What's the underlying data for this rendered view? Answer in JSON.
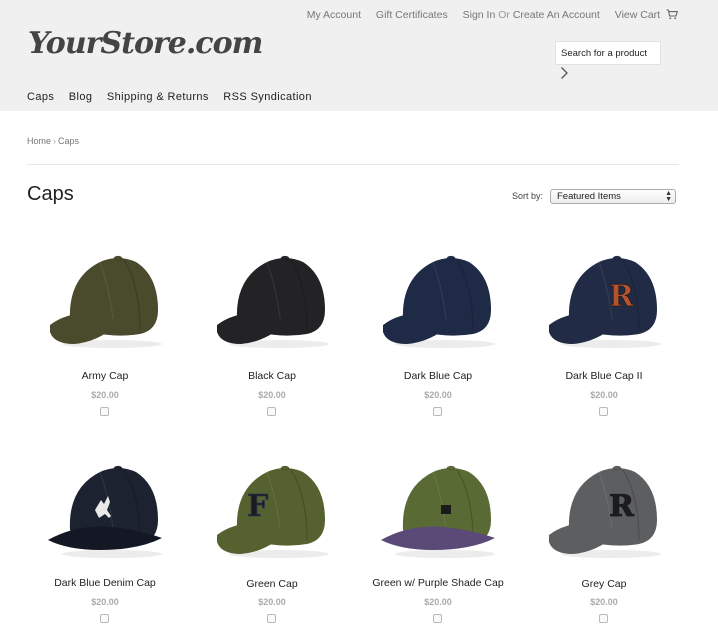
{
  "header": {
    "top_links": {
      "my_account": "My Account",
      "gift_certificates": "Gift Certificates",
      "sign_in": "Sign In",
      "or": "Or",
      "create_account": "Create An Account",
      "view_cart": "View Cart"
    },
    "logo": "YourStore.com",
    "search_placeholder": "Search for a product",
    "nav": [
      "Caps",
      "Blog",
      "Shipping & Returns",
      "RSS Syndication"
    ]
  },
  "breadcrumb": {
    "home": "Home",
    "sep": "›",
    "current": "Caps"
  },
  "page_title": "Caps",
  "sort": {
    "label": "Sort by:",
    "selected": "Featured Items"
  },
  "products": [
    {
      "name": "Army Cap",
      "price": "$20.00",
      "crown": "#4a4a2c",
      "brim": "#4a4a2c",
      "logo": ""
    },
    {
      "name": "Black Cap",
      "price": "$20.00",
      "crown": "#232326",
      "brim": "#232326",
      "logo": ""
    },
    {
      "name": "Dark Blue Cap",
      "price": "$20.00",
      "crown": "#1f2a47",
      "brim": "#1f2a47",
      "logo": ""
    },
    {
      "name": "Dark Blue Cap II",
      "price": "$20.00",
      "crown": "#222b45",
      "brim": "#222b45",
      "logo": "R"
    },
    {
      "name": "Dark Blue Denim Cap",
      "price": "$20.00",
      "crown": "#1c2230",
      "brim": "#141824",
      "logo": "deer"
    },
    {
      "name": "Green Cap",
      "price": "$20.00",
      "crown": "#55622f",
      "brim": "#55622f",
      "logo": "F"
    },
    {
      "name": "Green w/ Purple Shade Cap",
      "price": "$20.00",
      "crown": "#5a6a34",
      "brim": "#5b4a78",
      "logo": "patch"
    },
    {
      "name": "Grey Cap",
      "price": "$20.00",
      "crown": "#5d5e60",
      "brim": "#5d5e60",
      "logo": "R"
    }
  ],
  "colors": {
    "header_bg": "#f0f0f0",
    "logo_r_orange": "#b5532d",
    "logo_letter_dark": "#1b1b22"
  }
}
